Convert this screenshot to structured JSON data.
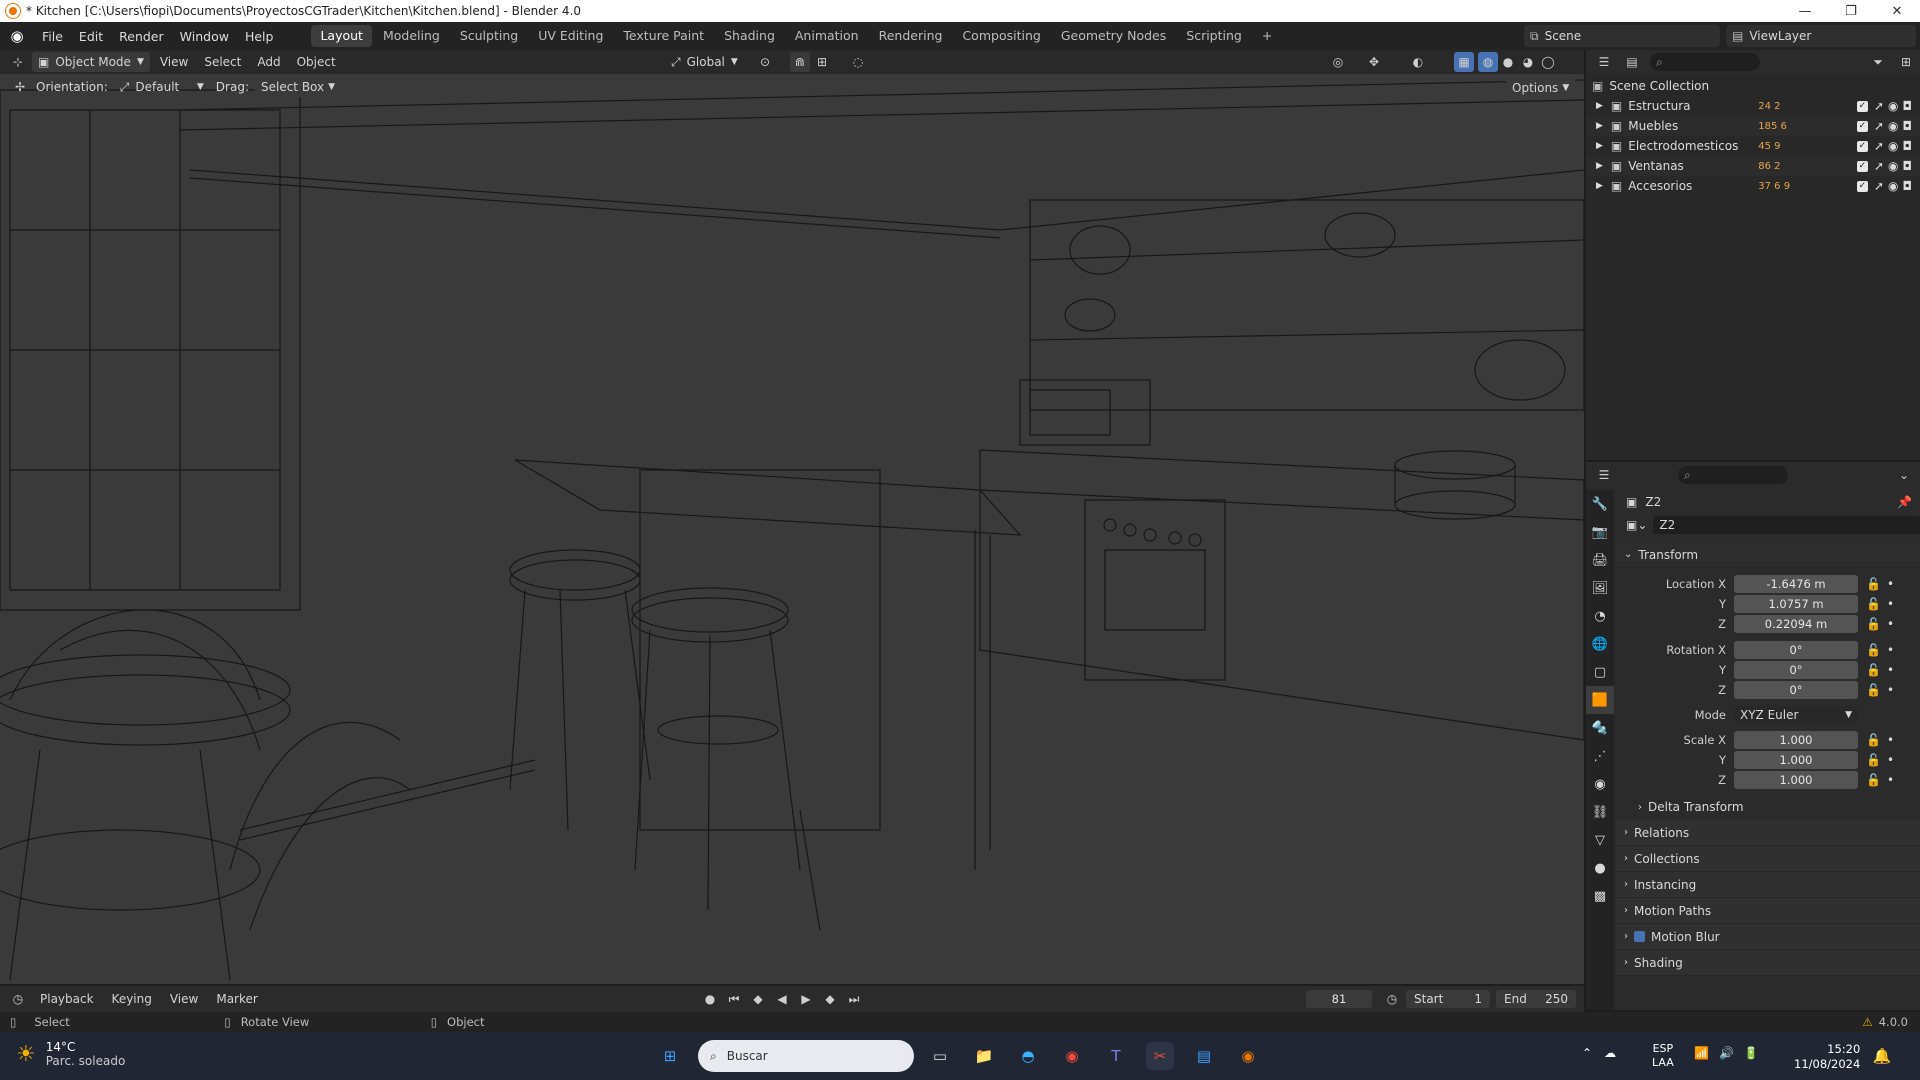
{
  "titlebar": {
    "title": "* Kitchen [C:\\Users\\fiopi\\Documents\\ProyectosCGTrader\\Kitchen\\Kitchen.blend] - Blender 4.0"
  },
  "menu": [
    "File",
    "Edit",
    "Render",
    "Window",
    "Help"
  ],
  "workspaces": [
    "Layout",
    "Modeling",
    "Sculpting",
    "UV Editing",
    "Texture Paint",
    "Shading",
    "Animation",
    "Rendering",
    "Compositing",
    "Geometry Nodes",
    "Scripting"
  ],
  "active_workspace": "Layout",
  "scene": {
    "name": "Scene",
    "view_layer": "ViewLayer"
  },
  "viewport_header": {
    "mode": "Object Mode",
    "menus": [
      "View",
      "Select",
      "Add",
      "Object"
    ],
    "transform": "Global"
  },
  "tool_header": {
    "orientation_label": "Orientation:",
    "orientation_value": "Default",
    "drag_label": "Drag:",
    "drag_value": "Select Box",
    "options": "Options"
  },
  "outliner": {
    "root": "Scene Collection",
    "items": [
      {
        "name": "Estructura",
        "badge": "24 2"
      },
      {
        "name": "Muebles",
        "badge": "185 6"
      },
      {
        "name": "Electrodomesticos",
        "badge": "45 9"
      },
      {
        "name": "Ventanas",
        "badge": "86 2"
      },
      {
        "name": "Accesorios",
        "badge": "37 6 9"
      }
    ]
  },
  "properties": {
    "object_name": "Z2",
    "data_name": "Z2",
    "transform_label": "Transform",
    "location": {
      "label": "Location X",
      "x": "-1.6476 m",
      "y": "1.0757 m",
      "z": "0.22094 m"
    },
    "rotation": {
      "label": "Rotation X",
      "x": "0°",
      "y": "0°",
      "z": "0°"
    },
    "mode_label": "Mode",
    "mode_value": "XYZ Euler",
    "scale": {
      "label": "Scale X",
      "x": "1.000",
      "y": "1.000",
      "z": "1.000"
    },
    "axis_y": "Y",
    "axis_z": "Z",
    "panels": [
      "Delta Transform",
      "Relations",
      "Collections",
      "Instancing",
      "Motion Paths",
      "Motion Blur",
      "Shading"
    ]
  },
  "timeline": {
    "menus": [
      "Playback",
      "Keying",
      "View",
      "Marker"
    ],
    "current_frame": "81",
    "start_label": "Start",
    "start": "1",
    "end_label": "End",
    "end": "250"
  },
  "statusbar": {
    "select": "Select",
    "rotate": "Rotate View",
    "object": "Object",
    "version": "4.0.0"
  },
  "taskbar": {
    "weather_temp": "14°C",
    "weather_desc": "Parc. soleado",
    "search": "Buscar",
    "lang1": "ESP",
    "lang2": "LAA",
    "time": "15:20",
    "date": "11/08/2024"
  },
  "colors": {
    "accent": "#4772b3",
    "bg": "#1d1d1d",
    "viewport": "#3a3a3a"
  }
}
